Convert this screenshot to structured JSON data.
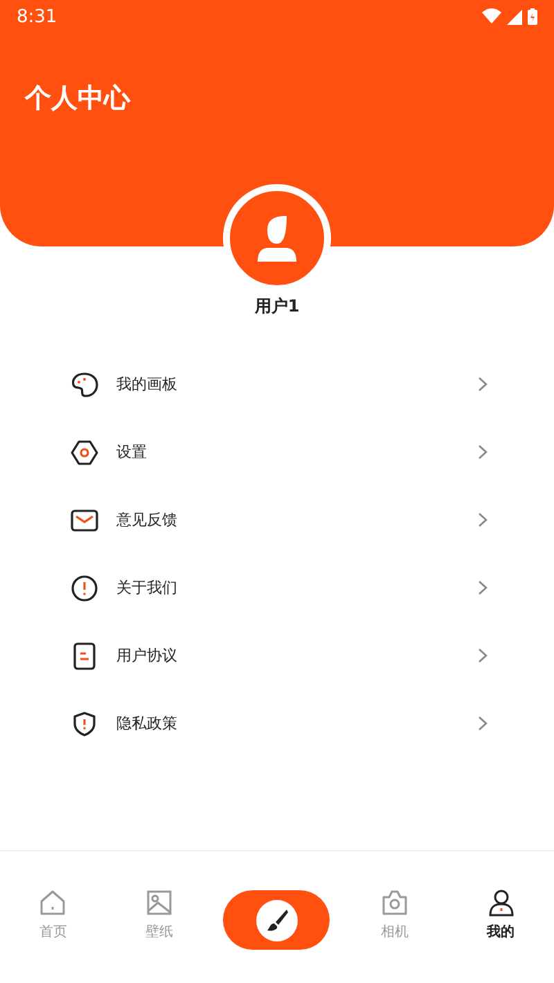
{
  "status_bar": {
    "time": "8:31"
  },
  "header": {
    "title": "个人中心"
  },
  "profile": {
    "name": "用户1"
  },
  "menu": [
    {
      "kind": "palette",
      "label": "我的画板"
    },
    {
      "kind": "gear",
      "label": "设置"
    },
    {
      "kind": "mail",
      "label": "意见反馈"
    },
    {
      "kind": "info",
      "label": "关于我们"
    },
    {
      "kind": "doc",
      "label": "用户协议"
    },
    {
      "kind": "shield",
      "label": "隐私政策"
    }
  ],
  "nav": [
    {
      "kind": "home",
      "label": "首页",
      "selected": false
    },
    {
      "kind": "image",
      "label": "壁纸",
      "selected": false
    },
    {
      "kind": "brush",
      "selected": false
    },
    {
      "kind": "camera",
      "label": "相机",
      "selected": false
    },
    {
      "kind": "user",
      "label": "我的",
      "selected": true
    }
  ]
}
